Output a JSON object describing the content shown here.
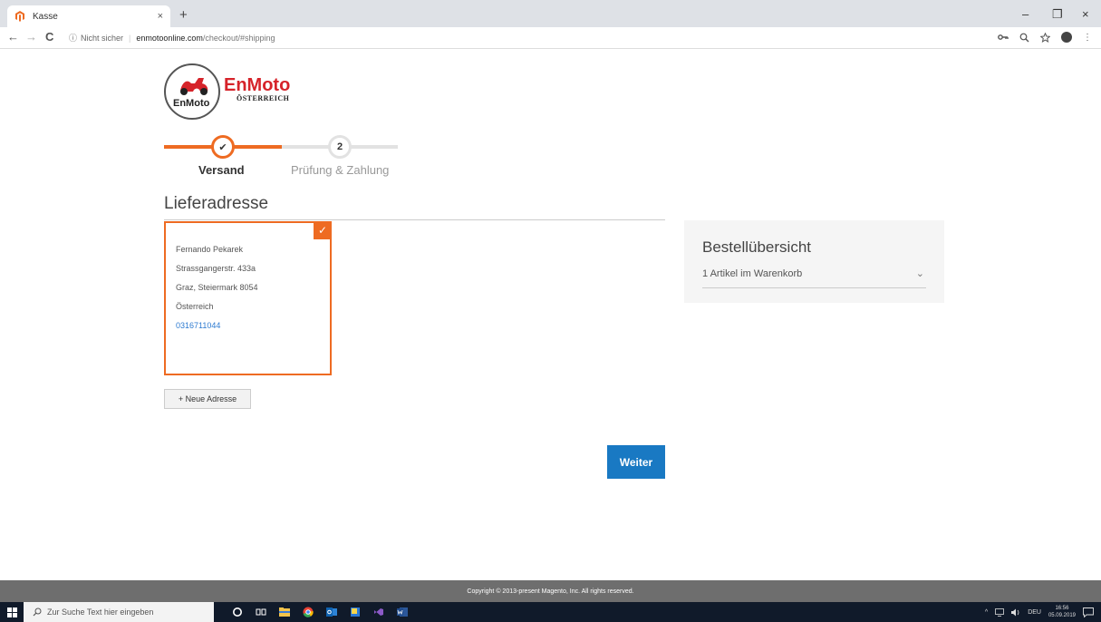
{
  "browser": {
    "tab_title": "Kasse",
    "tab_close": "×",
    "new_tab": "+",
    "window_controls": [
      "–",
      "❐",
      "×"
    ],
    "nav": {
      "back": "←",
      "forward": "→",
      "reload": "C"
    },
    "url_info": "ⓘ",
    "url_security": "Nicht sicher",
    "url_separator": "|",
    "url_domain": "enmotoonline.com",
    "url_path": "/checkout/#shipping",
    "toolbar_icons": [
      "key-icon",
      "zoom-icon",
      "star-icon",
      "profile-icon",
      "menu-icon"
    ],
    "menu_glyph": "⋮"
  },
  "logo": {
    "circle_text": "EnMoto",
    "word": "EnMoto",
    "sub": "ÖSTERREICH"
  },
  "progress": {
    "steps": [
      {
        "label": "Versand",
        "marker": "✔",
        "state": "complete"
      },
      {
        "label": "Prüfung & Zahlung",
        "marker": "2",
        "state": "pending"
      }
    ],
    "accent": "#ee6b22"
  },
  "shipping": {
    "title": "Lieferadresse",
    "selected_check": "✓",
    "address": {
      "name": "Fernando Pekarek",
      "street": "Strassgangerstr. 433a",
      "city": "Graz, Steiermark 8054",
      "country": "Österreich",
      "phone": "0316711044"
    },
    "new_address_label": "+ Neue Adresse",
    "next_label": "Weiter"
  },
  "summary": {
    "title": "Bestellübersicht",
    "cart_text": "1 Artikel im Warenkorb",
    "chevron": "⌄"
  },
  "footer": {
    "text": "Copyright © 2013-present Magento, Inc. All rights reserved."
  },
  "taskbar": {
    "search_placeholder": "Zur Suche Text hier eingeben",
    "language": "DEU",
    "time": "16:56",
    "date": "05.09.2019",
    "tray_up": "^"
  },
  "colors": {
    "brand_orange": "#ee6b22",
    "primary_blue": "#1979c3",
    "logo_red": "#d6232a",
    "link_blue": "#2e7bd1"
  }
}
